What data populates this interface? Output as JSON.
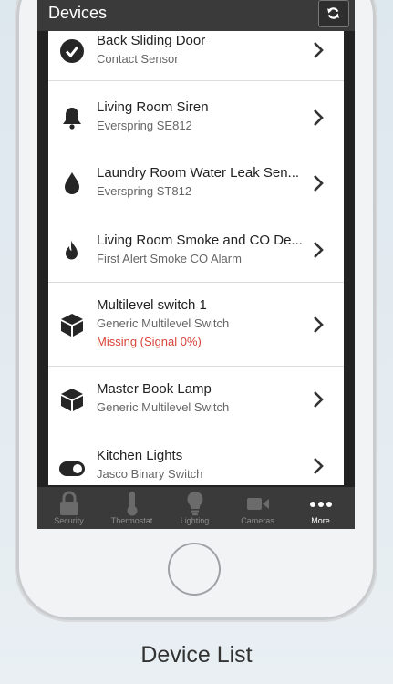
{
  "header": {
    "title": "Devices",
    "refresh_icon": "refresh-icon"
  },
  "devices": [
    {
      "name": "Back Sliding Door",
      "type": "Contact Sensor",
      "status": "",
      "icon": "check-circle-icon"
    },
    {
      "name": "Living Room Siren",
      "type": "Everspring SE812",
      "status": "",
      "icon": "bell-icon"
    },
    {
      "name": "Laundry Room Water Leak Sen...",
      "type": "Everspring ST812",
      "status": "",
      "icon": "water-drop-icon"
    },
    {
      "name": "Living Room Smoke and CO De...",
      "type": "First Alert Smoke CO Alarm",
      "status": "",
      "icon": "flame-icon"
    },
    {
      "name": "Multilevel switch 1",
      "type": "Generic Multilevel Switch",
      "status": "Missing (Signal 0%)",
      "icon": "cube-icon"
    },
    {
      "name": "Master Book Lamp",
      "type": "Generic Multilevel Switch",
      "status": "",
      "icon": "cube-icon"
    },
    {
      "name": "Kitchen Lights",
      "type": "Jasco Binary Switch",
      "status": "",
      "icon": "toggle-icon"
    }
  ],
  "tabs": [
    {
      "label": "Security",
      "icon": "lock-icon"
    },
    {
      "label": "Thermostat",
      "icon": "thermometer-icon"
    },
    {
      "label": "Lighting",
      "icon": "lightbulb-icon"
    },
    {
      "label": "Cameras",
      "icon": "video-camera-icon"
    },
    {
      "label": "More",
      "icon": "more-icon",
      "active": true
    }
  ],
  "caption": "Device List",
  "colors": {
    "header": "#3a3a3a",
    "status_missing": "#d9443a",
    "tab_inactive": "#8d8d8d"
  }
}
